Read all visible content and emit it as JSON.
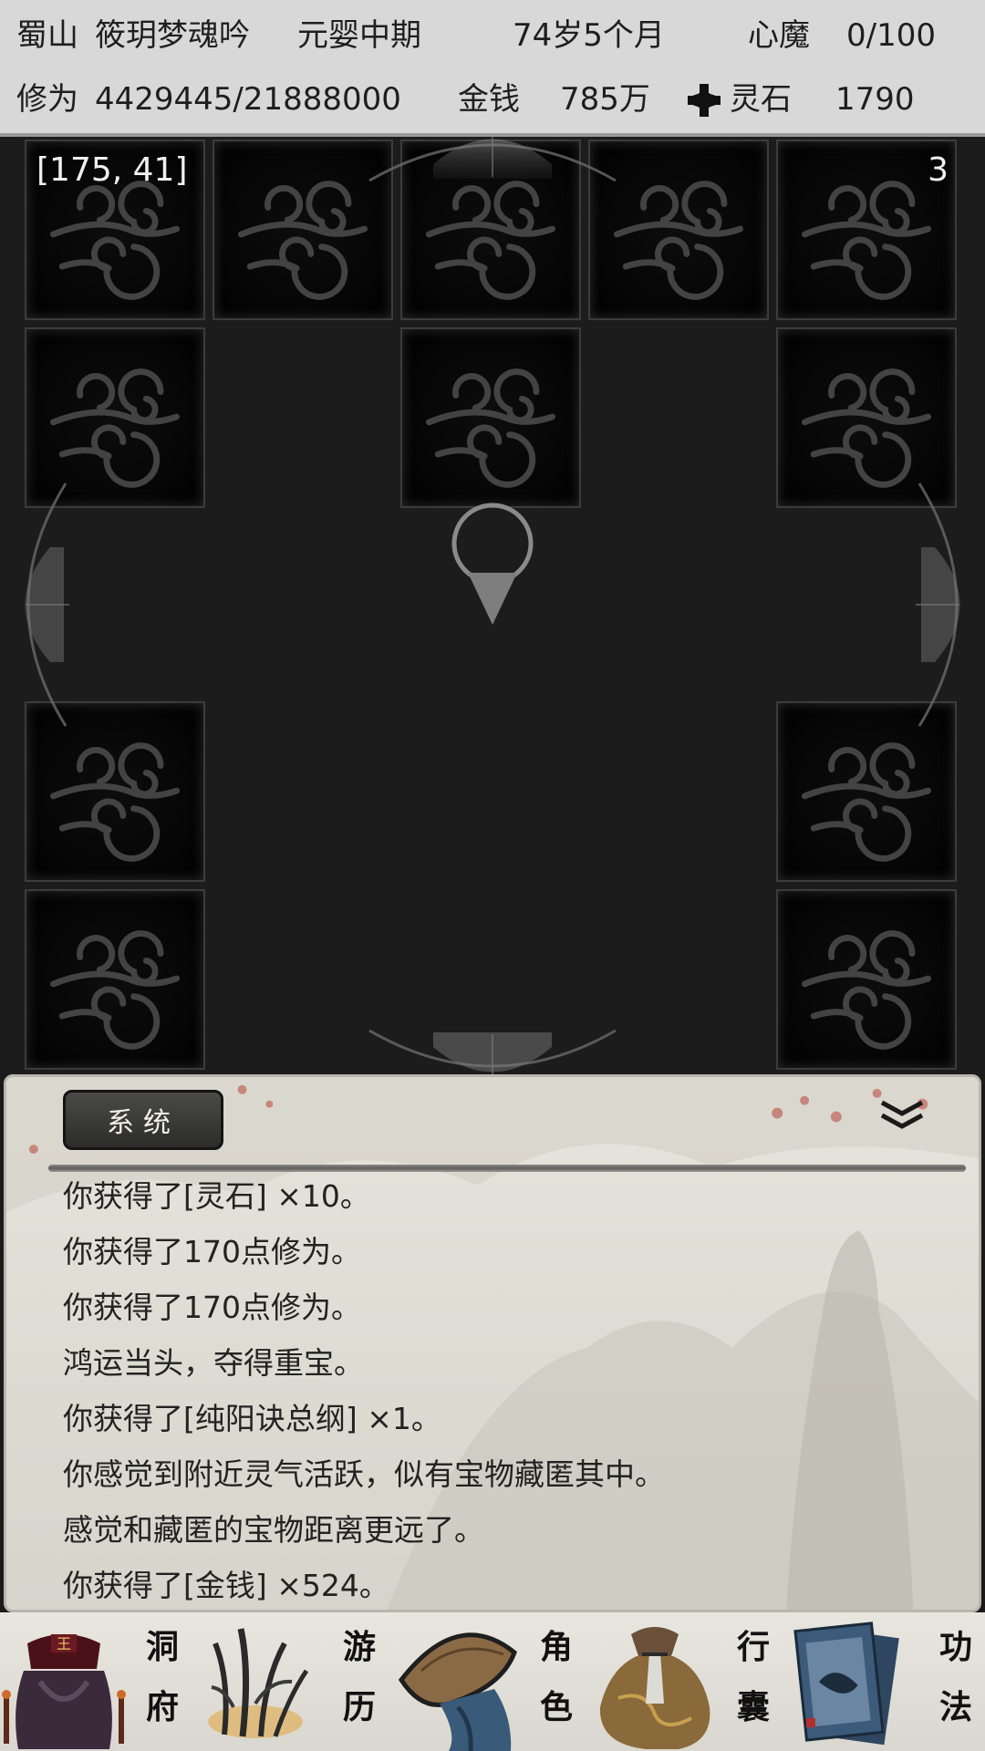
{
  "status": {
    "location": "蜀山",
    "name": "筱玥梦魂吟",
    "realm": "元婴中期",
    "age": "74岁5个月",
    "heart_demon_label": "心魔",
    "heart_demon_value": "0/100",
    "cultivation_label": "修为",
    "cultivation_value": "4429445/21888000",
    "money_label": "金钱",
    "money_value": "785万",
    "spirit_stone_label": "灵石",
    "spirit_stone_value": "1790"
  },
  "map": {
    "coordinates": "[175, 41]",
    "floor": "3"
  },
  "log": {
    "tab_label": "系统",
    "messages": [
      "你获得了[灵石] ×10。",
      "你获得了170点修为。",
      "你获得了170点修为。",
      "鸿运当头，夺得重宝。",
      "你获得了[纯阳诀总纲] ×1。",
      "你感觉到附近灵气活跃，似有宝物藏匿其中。",
      "感觉和藏匿的宝物距离更远了。",
      "你获得了[金钱] ×524。"
    ]
  },
  "nav": {
    "cave_line1": "洞",
    "cave_line2": "府",
    "travel_line1": "游",
    "travel_line2": "历",
    "role_line1": "角",
    "role_line2": "色",
    "bag_line1": "行",
    "bag_line2": "囊",
    "skill_line1": "功",
    "skill_line2": "法"
  }
}
